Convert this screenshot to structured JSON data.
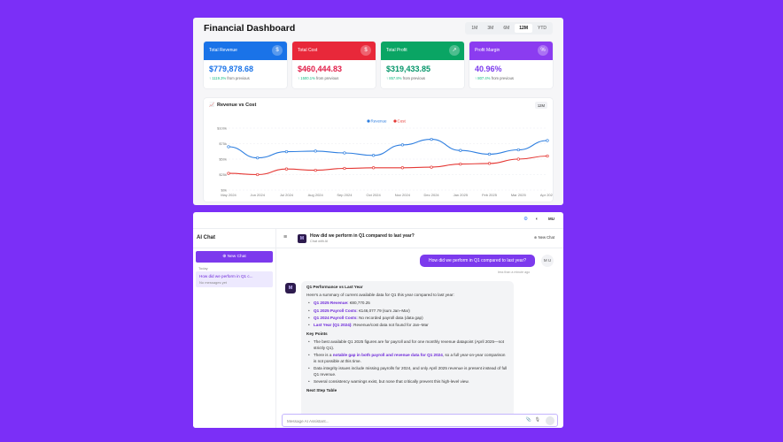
{
  "dashboard": {
    "title": "Financial Dashboard",
    "ranges": [
      "1M",
      "3M",
      "6M",
      "12M",
      "YTD"
    ],
    "active_range": "12M",
    "cards": [
      {
        "label": "Total Revenue",
        "value": "$779,878.68",
        "change": "1119.3%",
        "suffix": "from previous",
        "icon": "$",
        "icon_name": "dollar-icon",
        "color": "#1a73e8",
        "value_color": "#1a73e8"
      },
      {
        "label": "Total Cost",
        "value": "$460,444.83",
        "change": "1500.1%",
        "suffix": "from previous",
        "icon": "$",
        "icon_name": "dollar-icon",
        "color": "#e8283a",
        "value_color": "#e11d48"
      },
      {
        "label": "Total Profit",
        "value": "$319,433.85",
        "change": "857.8%",
        "suffix": "from previous",
        "icon": "↗",
        "icon_name": "trend-up-icon",
        "color": "#0aa564",
        "value_color": "#059669"
      },
      {
        "label": "Profit Margin",
        "value": "40.96%",
        "change": "807.4%",
        "suffix": "from previous",
        "icon": "%",
        "icon_name": "percent-icon",
        "color": "#8b3cf0",
        "value_color": "#7c3aed"
      }
    ],
    "chart_title": "Revenue vs Cost",
    "chart_badge": "12M"
  },
  "chart_data": {
    "type": "line",
    "title": "Revenue vs Cost",
    "categories": [
      "May 2024",
      "Jun 2024",
      "Jul 2024",
      "Aug 2024",
      "Sep 2024",
      "Oct 2024",
      "Nov 2024",
      "Dec 2024",
      "Jan 2025",
      "Feb 2025",
      "Mar 2025",
      "Apr 2025"
    ],
    "series": [
      {
        "name": "Revenue",
        "color": "#2f7fe0",
        "values": [
          70000,
          52000,
          62000,
          63000,
          60000,
          56000,
          73000,
          82000,
          64000,
          58000,
          65000,
          80000
        ]
      },
      {
        "name": "Cost",
        "color": "#e53935",
        "values": [
          27000,
          25000,
          34000,
          32000,
          35000,
          36000,
          36000,
          37000,
          42000,
          43000,
          50000,
          55000
        ]
      }
    ],
    "yticks": [
      "$0k",
      "$25k",
      "$50k",
      "$75k",
      "$100k"
    ],
    "ylim": [
      0,
      100000
    ],
    "legend": "top-center",
    "grid": true
  },
  "app": {
    "settings_icon": "⚙",
    "theme_icon": "◐",
    "user_initials": "MU"
  },
  "sidebar": {
    "title": "AI Chat",
    "new_chat": "New Chat",
    "section": "Today",
    "conversation": {
      "title": "How did we perform in Q1 c...",
      "subtitle": "No messages yet"
    }
  },
  "chat": {
    "title": "How did we perform in Q1 compared to last year?",
    "subtitle": "Chat with AI",
    "new_chat": "New Chat",
    "user_message": "How did we perform in Q1 compared to last year?",
    "user_avatar": "M U",
    "time": "less than a minute ago",
    "response": {
      "heading": "Q1 Performance vs Last Year",
      "intro": "Here's a summary of current available data for Q1 this year compared to last year:",
      "bullets": [
        {
          "label": "Q1 2025 Revenue:",
          "text": "€80,770.25"
        },
        {
          "label": "Q1 2025 Payroll Costs:",
          "text": "€146,077.79 (sum Jan–Mar)"
        },
        {
          "label": "Q1 2024 Payroll Costs:",
          "text": "No recorded payroll data (data gap)"
        },
        {
          "label": "Last Year (Q1 2024):",
          "text": "Revenue/cost data not found for Jan–Mar"
        }
      ],
      "key_points_heading": "Key Points",
      "points": [
        {
          "pre": "The best available Q1 2025 figures are for payroll and for one monthly revenue datapoint (April 2025—not strictly Q1).",
          "hl": "",
          "post": ""
        },
        {
          "pre": "There is a ",
          "hl": "notable gap in both payroll and revenue data for Q1 2024",
          "post": ", so a full year-on-year comparison is not possible at this time."
        },
        {
          "pre": "Data integrity issues include missing payrolls for 2024, and only April 2025 revenue is present instead of full Q1 revenue.",
          "hl": "",
          "post": ""
        },
        {
          "pre": "Several consistency warnings exist, but none that critically prevent this high-level view.",
          "hl": "",
          "post": ""
        }
      ],
      "trailing": "Next Step Table"
    },
    "input_placeholder": "Message AI Assistant...",
    "attach_icon": "📎",
    "mic_icon": "🎙"
  }
}
